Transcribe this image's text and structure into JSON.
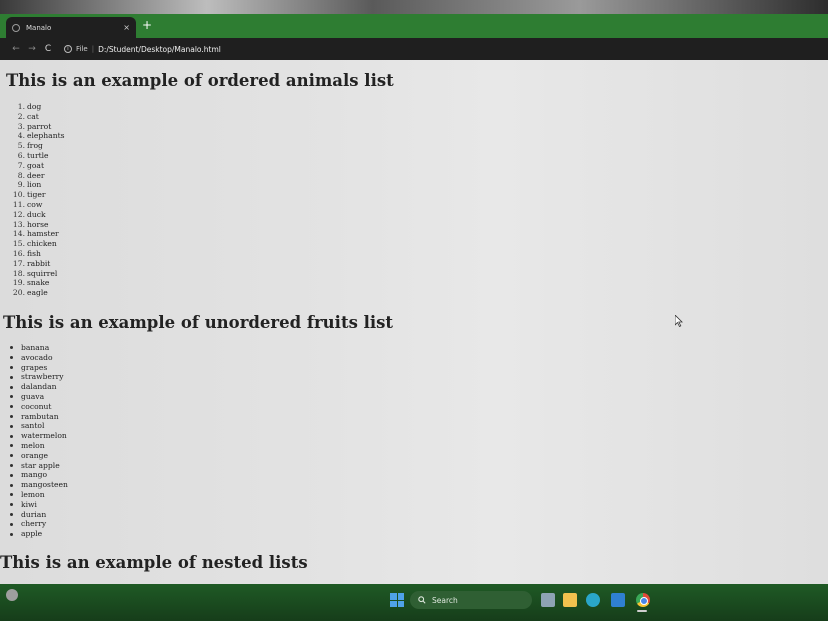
{
  "browser": {
    "tab_title": "Manalo",
    "tab_close": "×",
    "new_tab": "+",
    "url_scheme": "File",
    "url": "D:/Student/Desktop/Manalo.html",
    "nav": {
      "back": "←",
      "forward": "→",
      "reload": "C"
    }
  },
  "page": {
    "animals_heading": "This is an example of ordered animals list",
    "animals": [
      "dog",
      "cat",
      "parrot",
      "elephants",
      "frog",
      "turtle",
      "goat",
      "deer",
      "lion",
      "tiger",
      "cow",
      "duck",
      "horse",
      "hamster",
      "chicken",
      "fish",
      "rabbit",
      "squirrel",
      "snake",
      "eagle"
    ],
    "fruits_heading": "This is an example of unordered fruits list",
    "fruits": [
      "banana",
      "avocado",
      "grapes",
      "strawberry",
      "dalandan",
      "guava",
      "coconut",
      "rambutan",
      "santol",
      "watermelon",
      "melon",
      "orange",
      "star apple",
      "mango",
      "mangosteen",
      "lemon",
      "kiwi",
      "durian",
      "cherry",
      "apple"
    ],
    "nested_heading": "This is an example of nested lists"
  },
  "taskbar": {
    "search_label": "Search",
    "icons": [
      "widgets-icon",
      "start-icon",
      "search-icon",
      "file-explorer-icon",
      "folder-icon",
      "edge-icon",
      "vscode-icon",
      "chrome-icon"
    ]
  }
}
